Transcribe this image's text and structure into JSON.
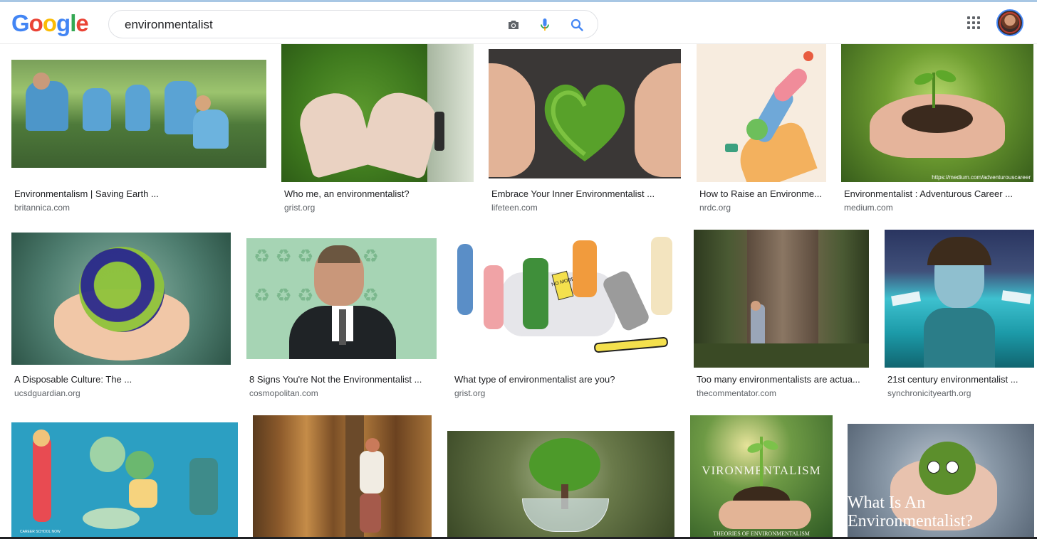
{
  "header": {
    "logo_letters": [
      "G",
      "o",
      "o",
      "g",
      "l",
      "e"
    ],
    "logo_colors": [
      "#4285f4",
      "#ea4335",
      "#fbbc05",
      "#4285f4",
      "#34a853",
      "#ea4335"
    ],
    "search_query": "environmentalist",
    "icons": {
      "camera": "camera-icon",
      "mic": "microphone-icon",
      "search": "search-icon",
      "apps": "apps-grid-icon",
      "avatar": "account-avatar"
    }
  },
  "results": [
    {
      "title": "Environmentalism | Saving Earth ...",
      "source": "britannica.com",
      "image": "volunteers-picking-litter"
    },
    {
      "title": "Who me, an environmentalist?",
      "source": "grist.org",
      "image": "heart-hands-on-moss"
    },
    {
      "title": "Embrace Your Inner Environmentalist ...",
      "source": "lifeteen.com",
      "image": "hands-around-moss-heart"
    },
    {
      "title": "How to Raise an Environme...",
      "source": "nrdc.org",
      "image": "illustrated-hand-with-plants"
    },
    {
      "title": "Environmentalist : Adventurous Career ...",
      "source": "medium.com",
      "image": "hands-holding-seedling",
      "watermark": "https://medium.com/adventurouscareer"
    },
    {
      "title": "A Disposable Culture: The ...",
      "source": "ucsdguardian.org",
      "image": "hands-holding-earth"
    },
    {
      "title": "8 Signs You're Not the Environmentalist ...",
      "source": "cosmopolitan.com",
      "image": "man-recycling-background"
    },
    {
      "title": "What type of environmentalist are you?",
      "source": "grist.org",
      "image": "cartoon-environmentalists",
      "sign_text": "NO MORE!"
    },
    {
      "title": "Too many environmentalists are actua...",
      "source": "thecommentator.com",
      "image": "person-hugging-redwood"
    },
    {
      "title": "21st century environmentalist ...",
      "source": "synchronicityearth.org",
      "image": "painting-girl-underwater"
    },
    {
      "title": "",
      "source": "",
      "image": "illustrated-gardeners",
      "watermark": "CAREER SCHOOL NOW"
    },
    {
      "title": "",
      "source": "",
      "image": "man-hugging-tree"
    },
    {
      "title": "",
      "source": "",
      "image": "tree-in-glass-globe"
    },
    {
      "title": "",
      "source": "",
      "image": "seedling-environmentalism",
      "overlay_top": "VIRONMENTALISM",
      "overlay_bottom": "THEORIES OF ENVIRONMENTALISM"
    },
    {
      "title": "",
      "source": "",
      "image": "moss-ball-with-eyes",
      "overlay_top": "What Is An",
      "overlay_bottom": "Environmentalist?"
    }
  ]
}
